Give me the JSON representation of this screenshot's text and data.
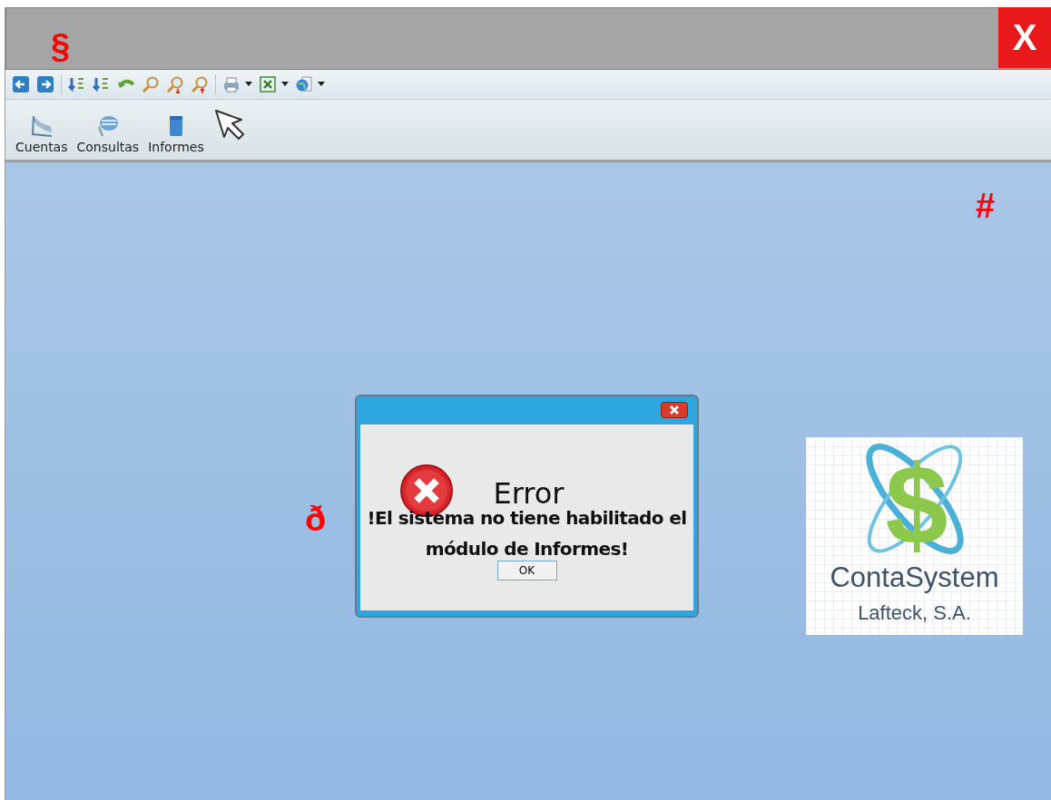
{
  "window": {
    "close_label": "X"
  },
  "annotations": [
    {
      "text": "§"
    },
    {
      "text": "#"
    },
    {
      "text": "ð"
    }
  ],
  "toolbar": [
    {
      "kind": "button"
    },
    {
      "kind": "button"
    },
    {
      "kind": "separator"
    },
    {
      "kind": "button"
    },
    {
      "kind": "button"
    },
    {
      "kind": "button"
    },
    {
      "kind": "button"
    },
    {
      "kind": "button"
    },
    {
      "kind": "button"
    },
    {
      "kind": "separator"
    },
    {
      "kind": "dropdown"
    },
    {
      "kind": "dropdown"
    },
    {
      "kind": "dropdown"
    }
  ],
  "ribbon": [
    {
      "label": "Cuentas"
    },
    {
      "label": "Consultas"
    },
    {
      "label": "Informes"
    }
  ],
  "dialog": {
    "heading": "Error",
    "message": "!El sistema no tiene habilitado el módulo de Informes!",
    "button": "OK"
  },
  "logo": {
    "symbol": "$",
    "name": "ContaSystem",
    "company": "Lafteck, S.A."
  }
}
